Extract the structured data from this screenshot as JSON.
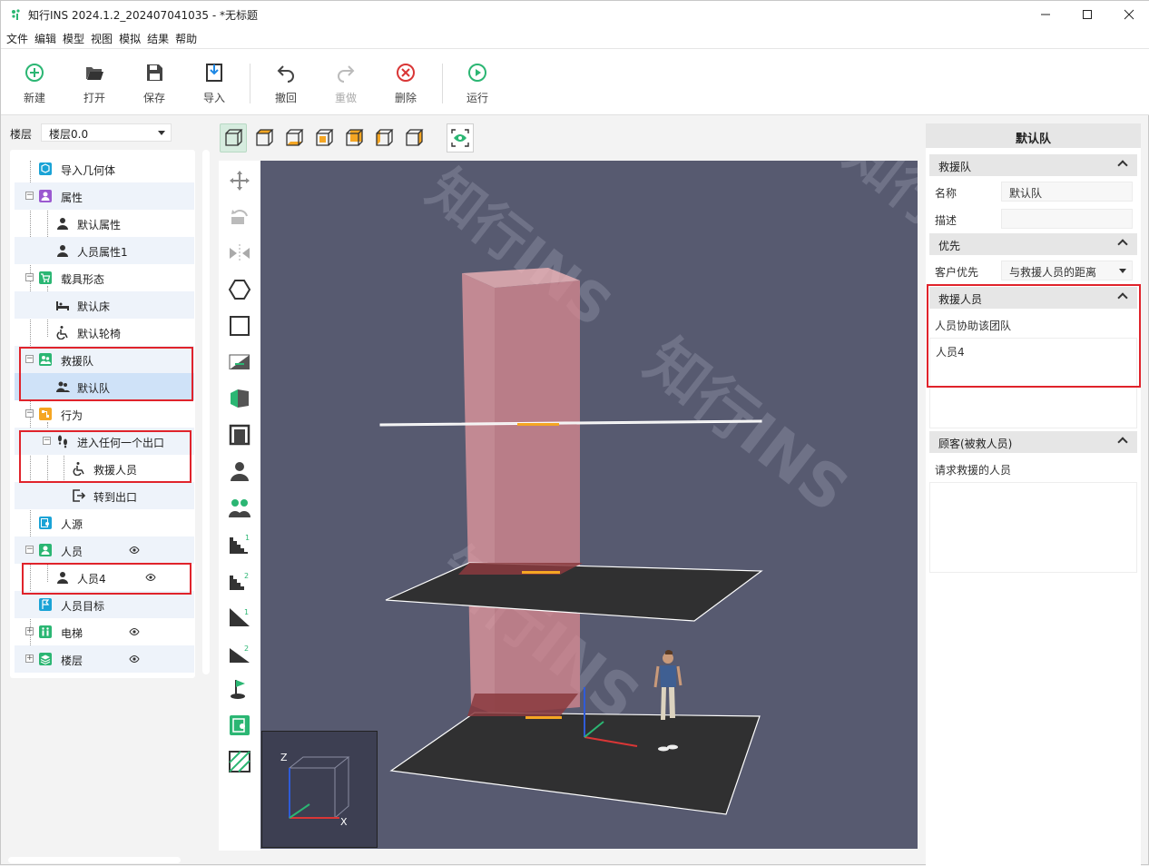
{
  "window": {
    "title": "知行INS 2024.1.2_202407041035 - *无标题",
    "controls": [
      "minimize",
      "maximize",
      "close"
    ]
  },
  "menu": [
    "文件",
    "编辑",
    "模型",
    "视图",
    "模拟",
    "结果",
    "帮助"
  ],
  "toolbar": {
    "new": "新建",
    "open": "打开",
    "save": "保存",
    "import": "导入",
    "undo": "撤回",
    "redo": "重做",
    "delete": "删除",
    "run": "运行"
  },
  "floor": {
    "label": "楼层",
    "value": "楼层0.0"
  },
  "tree": {
    "import_geometry": "导入几何体",
    "attributes": "属性",
    "default_attr": "默认属性",
    "person_attr1": "人员属性1",
    "carrier_shape": "载具形态",
    "default_bed": "默认床",
    "default_wheelchair": "默认轮椅",
    "rescue_team": "救援队",
    "default_team": "默认队",
    "behavior": "行为",
    "enter_exit": "进入任何一个出口",
    "rescue_person": "救援人员",
    "goto_exit": "转到出口",
    "person_source": "人源",
    "persons": "人员",
    "person4": "人员4",
    "person_target": "人员目标",
    "elevator": "电梯",
    "floors": "楼层"
  },
  "right_panel": {
    "title": "默认队",
    "section_team": "救援队",
    "name_label": "名称",
    "name_value": "默认队",
    "desc_label": "描述",
    "desc_value": "",
    "section_priority": "优先",
    "client_priority_label": "客户优先",
    "client_priority_value": "与救援人员的距离",
    "section_rescuers": "救援人员",
    "rescuers_hint": "人员协助该团队",
    "rescuer_item": "人员4",
    "section_clients": "顾客(被救人员)",
    "clients_hint": "请求救援的人员"
  },
  "minimap": {
    "axis_z": "Z",
    "axis_x": "X"
  },
  "watermark": "知行INS",
  "colors": {
    "accent": "#2bb673",
    "highlight": "#e0232b",
    "canvas": "#575a70"
  }
}
